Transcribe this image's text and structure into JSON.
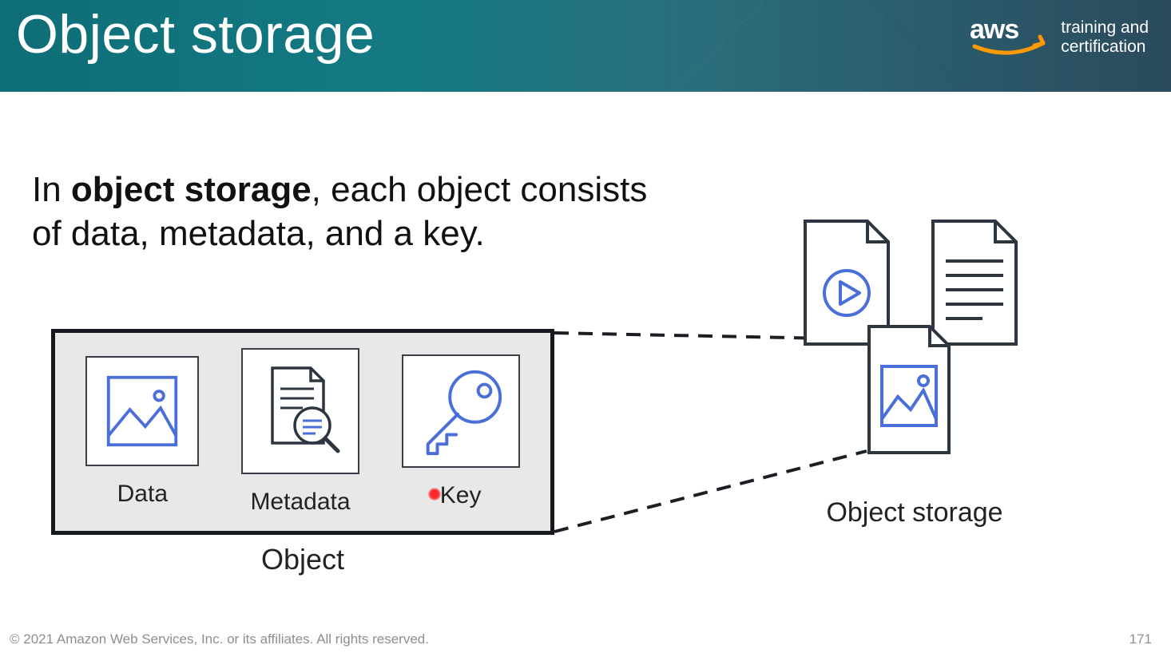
{
  "header": {
    "title": "Object storage",
    "brand_line1": "training and",
    "brand_line2": "certification"
  },
  "statement": {
    "prefix": "In ",
    "bold": "object storage",
    "rest": ", each object consists of data, metadata, and a key."
  },
  "object": {
    "items": [
      "Data",
      "Metadata",
      "Key"
    ],
    "caption": "Object"
  },
  "storage_label": "Object storage",
  "footer": {
    "copyright": "© 2021 Amazon Web Services, Inc. or its affiliates. All rights reserved.",
    "page": "171"
  },
  "colors": {
    "icon_blue": "#4a6fd8",
    "icon_dark": "#2d3540",
    "aws_orange": "#ff9900"
  }
}
